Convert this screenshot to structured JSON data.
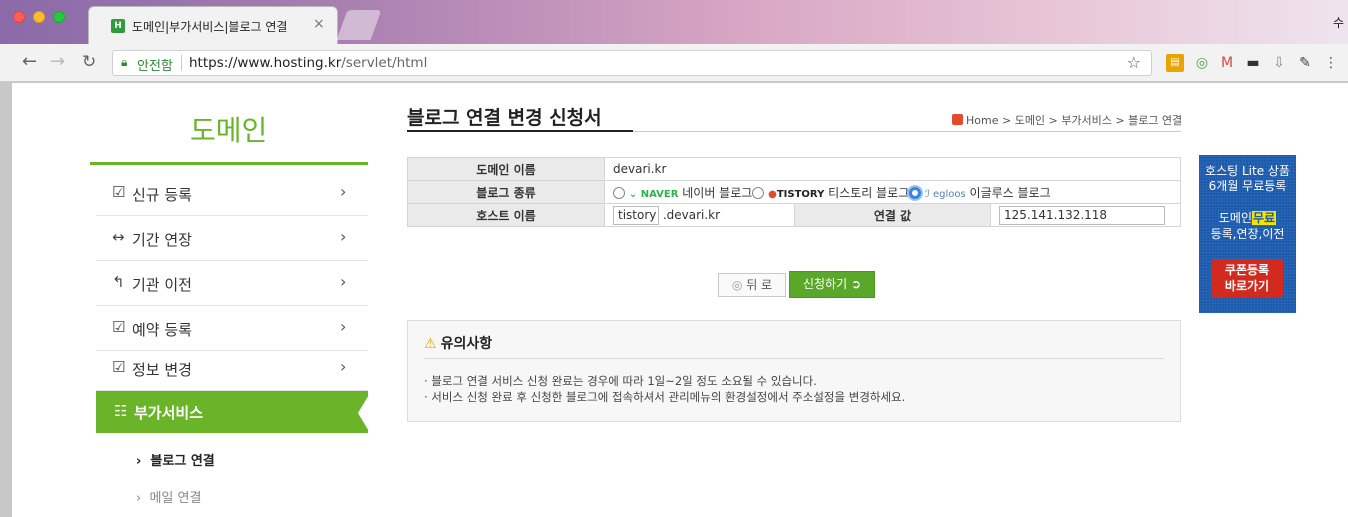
{
  "browser": {
    "tab_title": "도메인|부가서비스|블로그 연결",
    "tab_close": "×",
    "corner_text": "수",
    "secure_label": "안전함",
    "url_host": "https://www.hosting.kr",
    "url_path": "/servlet/html"
  },
  "sidebar": {
    "title": "도메인",
    "items": [
      {
        "icon": "edit-icon",
        "glyph": "☑",
        "label": "신규 등록"
      },
      {
        "icon": "arrows-icon",
        "glyph": "↔",
        "label": "기간 연장"
      },
      {
        "icon": "reply-icon",
        "glyph": "↰",
        "label": "기관 이전"
      },
      {
        "icon": "edit-icon",
        "glyph": "☑",
        "label": "예약 등록"
      },
      {
        "icon": "edit-icon",
        "glyph": "☑",
        "label": "정보 변경"
      }
    ],
    "active": {
      "icon": "sliders-icon",
      "glyph": "☷",
      "label": "부가서비스"
    },
    "sub_items": [
      "블로그 연결",
      "메일 연결"
    ]
  },
  "main": {
    "title": "블로그 연결 변경 신청서",
    "breadcrumb": "Home > 도메인 > 부가서비스 > 블로그 연결",
    "form": {
      "domain_label": "도메인 이름",
      "domain_value": "devari.kr",
      "blog_type_label": "블로그 종류",
      "naver_brand": "NAVER",
      "naver_label": "네이버 블로그",
      "tistory_brand": "TISTORY",
      "tistory_label": "티스토리 블로그",
      "egloos_brand": "egloos",
      "egloos_label": "이글루스 블로그",
      "selected_blog": "egloos",
      "host_label": "호스트 이름",
      "host_value": "tistory",
      "host_suffix": ".devari.kr",
      "conn_label": "연결 값",
      "conn_value": "125.141.132.118"
    },
    "buttons": {
      "back": "뒤 로",
      "apply": "신청하기"
    },
    "notice": {
      "title": "유의사항",
      "lines": [
        "· 블로그 연결 서비스 신청 완료는 경우에 따라 1일~2일 정도 소요될 수 있습니다.",
        "· 서비스 신청 완료 후 신청한 블로그에 접속하셔서 관리메뉴의 환경설정에서 주소설정을 변경하세요."
      ]
    }
  },
  "banner": {
    "line1": "호스팅 Lite 상품",
    "line2": "6개월 무료등록",
    "line3_a": "도메인",
    "line3_b": "무료",
    "line4": "등록,연장,이전",
    "button_line1": "쿠폰등록",
    "button_line2": "바로가기"
  },
  "colors": {
    "brand_green": "#6ab42a",
    "banner_blue": "#1f5aa8",
    "coupon_red": "#d22a1e"
  }
}
